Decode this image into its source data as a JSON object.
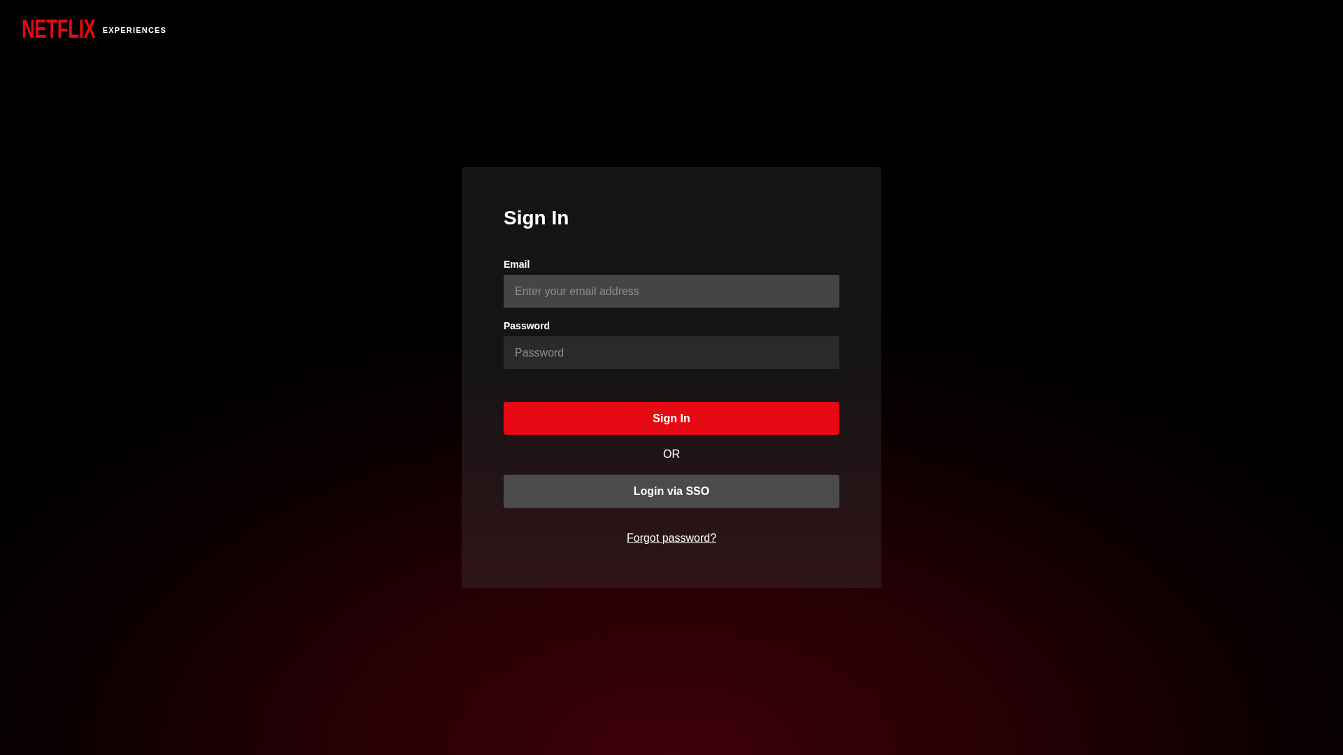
{
  "header": {
    "logo": "NETFLIX",
    "subtitle": "EXPERIENCES"
  },
  "form": {
    "title": "Sign In",
    "fields": [
      {
        "label": "Email",
        "placeholder": "Enter your email address",
        "focused": true
      },
      {
        "label": "Password",
        "placeholder": "Password",
        "focused": false
      }
    ],
    "primary_button": "Sign In",
    "separator": "OR",
    "sso_button": "Login via SSO",
    "forgot_link": "Forgot password?"
  }
}
